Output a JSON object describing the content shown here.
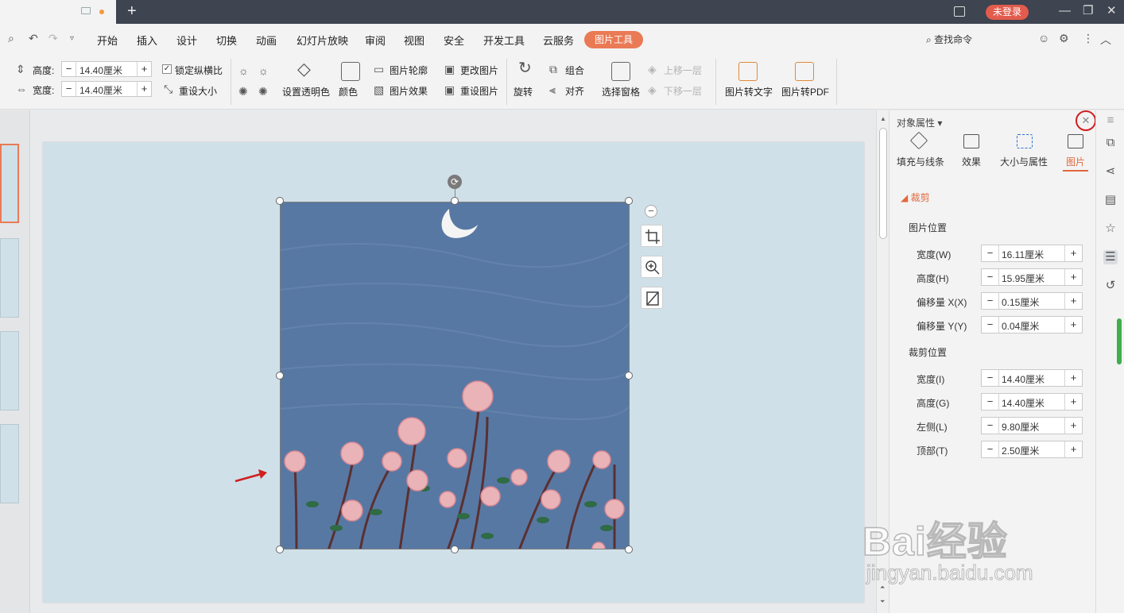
{
  "titlebar": {
    "login_label": "未登录"
  },
  "menu": {
    "items": [
      "开始",
      "插入",
      "设计",
      "切换",
      "动画",
      "幻灯片放映",
      "审阅",
      "视图",
      "安全",
      "开发工具",
      "云服务"
    ],
    "active_tab": "图片工具",
    "search_label": "查找命令"
  },
  "ribbon": {
    "height_label": "高度:",
    "height_value": "14.40厘米",
    "width_label": "宽度:",
    "width_value": "14.40厘米",
    "lock_ratio": "锁定纵横比",
    "reset_size": "重设大小",
    "set_transparent": "设置透明色",
    "color": "颜色",
    "outline": "图片轮廓",
    "effects": "图片效果",
    "change_pic": "更改图片",
    "reset_pic": "重设图片",
    "rotate": "旋转",
    "group": "组合",
    "align": "对齐",
    "select_pane": "选择窗格",
    "bring_forward": "上移一层",
    "send_backward": "下移一层",
    "pic_to_text": "图片转文字",
    "pic_to_pdf": "图片转PDF"
  },
  "panel": {
    "title": "对象属性",
    "tabs": [
      "填充与线条",
      "效果",
      "大小与属性",
      "图片"
    ],
    "active_tab_index": 3,
    "section": "裁剪",
    "picture_position": {
      "heading": "图片位置",
      "rows": [
        {
          "label": "宽度(W)",
          "value": "16.11厘米"
        },
        {
          "label": "高度(H)",
          "value": "15.95厘米"
        },
        {
          "label": "偏移量 X(X)",
          "value": "0.15厘米"
        },
        {
          "label": "偏移量 Y(Y)",
          "value": "0.04厘米"
        }
      ]
    },
    "crop_position": {
      "heading": "裁剪位置",
      "rows": [
        {
          "label": "宽度(I)",
          "value": "14.40厘米"
        },
        {
          "label": "高度(G)",
          "value": "14.40厘米"
        },
        {
          "label": "左侧(L)",
          "value": "9.80厘米"
        },
        {
          "label": "顶部(T)",
          "value": "2.50厘米"
        }
      ]
    }
  },
  "watermark": {
    "brand": "Bai经验",
    "url": "jingyan.baidu.com"
  },
  "colors": {
    "accent": "#ea7a55",
    "annotation": "#d01f1f",
    "picture_bg": "#5878a4",
    "slide_bg": "#cfe0e8"
  }
}
